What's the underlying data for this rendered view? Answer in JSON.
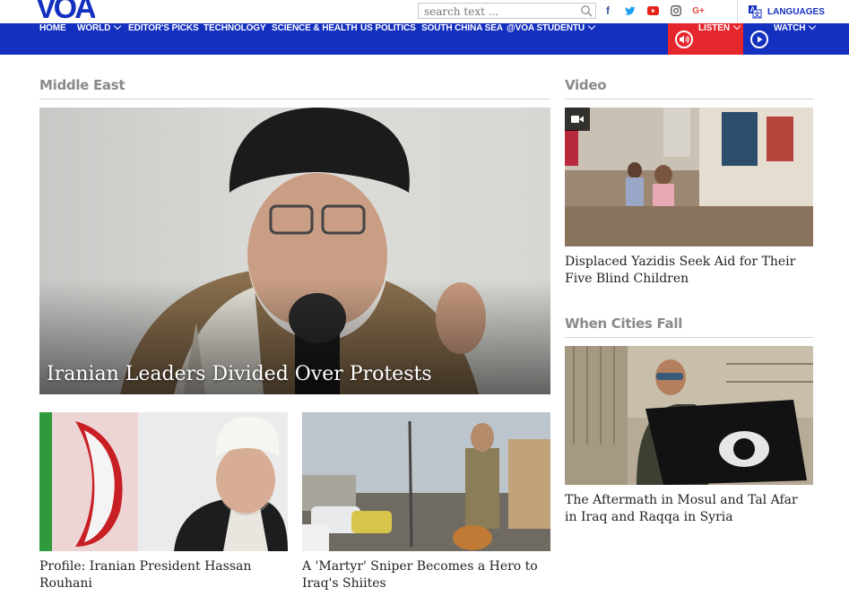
{
  "header": {
    "logo_text": "VOA",
    "search_placeholder": "search text ...",
    "languages_label": "LANGUAGES"
  },
  "social": [
    {
      "icon": "facebook-icon",
      "glyph": "f",
      "color": "#3b5998"
    },
    {
      "icon": "twitter-icon",
      "glyph": "t",
      "color": "#1da1f2"
    },
    {
      "icon": "youtube-icon",
      "glyph": "▶",
      "color": "#e62117"
    },
    {
      "icon": "instagram-icon",
      "glyph": "◎",
      "color": "#555555"
    },
    {
      "icon": "google-plus-icon",
      "glyph": "G+",
      "color": "#dd4b39"
    }
  ],
  "nav": {
    "items": [
      "HOME",
      "WORLD",
      "EDITOR'S PICKS",
      "TECHNOLOGY",
      "SCIENCE & HEALTH",
      "US POLITICS",
      "SOUTH CHINA SEA",
      "@VOA STUDENTU"
    ],
    "listen_label": "LISTEN",
    "watch_label": "WATCH"
  },
  "colors": {
    "brand": "#1330bf",
    "listen": "#e6262d",
    "section_title": "#8a8a8a"
  },
  "middle_east": {
    "title": "Middle East",
    "hero_title": "Iranian Leaders Divided Over Protests",
    "stories": [
      {
        "caption": "Profile: Iranian President Hassan Rouhani"
      },
      {
        "caption": "A 'Martyr' Sniper Becomes a Hero to Iraq's Shiites"
      }
    ]
  },
  "video": {
    "title": "Video",
    "caption": "Displaced Yazidis Seek Aid for Their Five Blind Children"
  },
  "cities": {
    "title": "When Cities Fall",
    "caption": "The Aftermath in Mosul and Tal Afar in Iraq and Raqqa in Syria"
  }
}
